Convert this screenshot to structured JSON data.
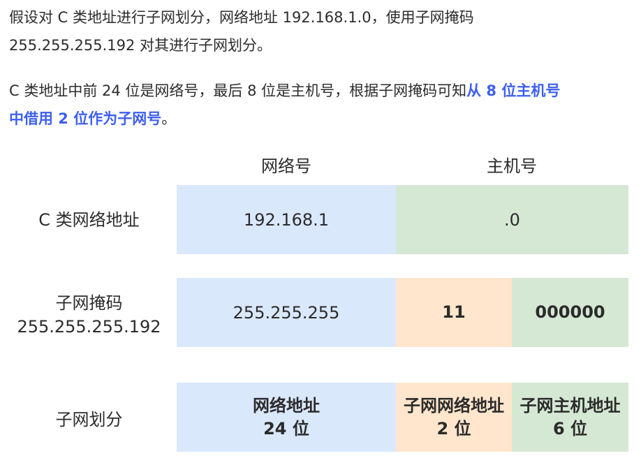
{
  "intro": {
    "line1": "假设对 C 类地址进行子网划分，网络地址 192.168.1.0，使用子网掩码",
    "line2": "255.255.255.192 对其进行子网划分。",
    "explanation_prefix": "C 类地址中前 24 位是网络号，最后 8 位是主机号，根据子网掩码可知",
    "explanation_highlight_a": "从 8 位主机号",
    "explanation_highlight_b": "中借用 2 位作为子网号",
    "explanation_suffix": "。"
  },
  "diagram": {
    "col_network": "网络号",
    "col_host": "主机号",
    "rows": [
      {
        "label": "C 类网络地址",
        "network": "192.168.1",
        "host": ".0"
      },
      {
        "label_line1": "子网掩码",
        "label_line2": "255.255.255.192",
        "network": "255.255.255",
        "subnet_bits": "11",
        "host_bits": "000000"
      },
      {
        "label": "子网划分",
        "network_line1": "网络地址",
        "network_line2": "24 位",
        "subnet_line1": "子网网络地址",
        "subnet_line2": "2 位",
        "host_line1": "子网主机地址",
        "host_line2": "6 位"
      }
    ],
    "colors": {
      "network": "#dae8fc",
      "host": "#d5e8d4",
      "subnet": "#ffe6cc",
      "highlight": "#3d5ff0"
    }
  }
}
